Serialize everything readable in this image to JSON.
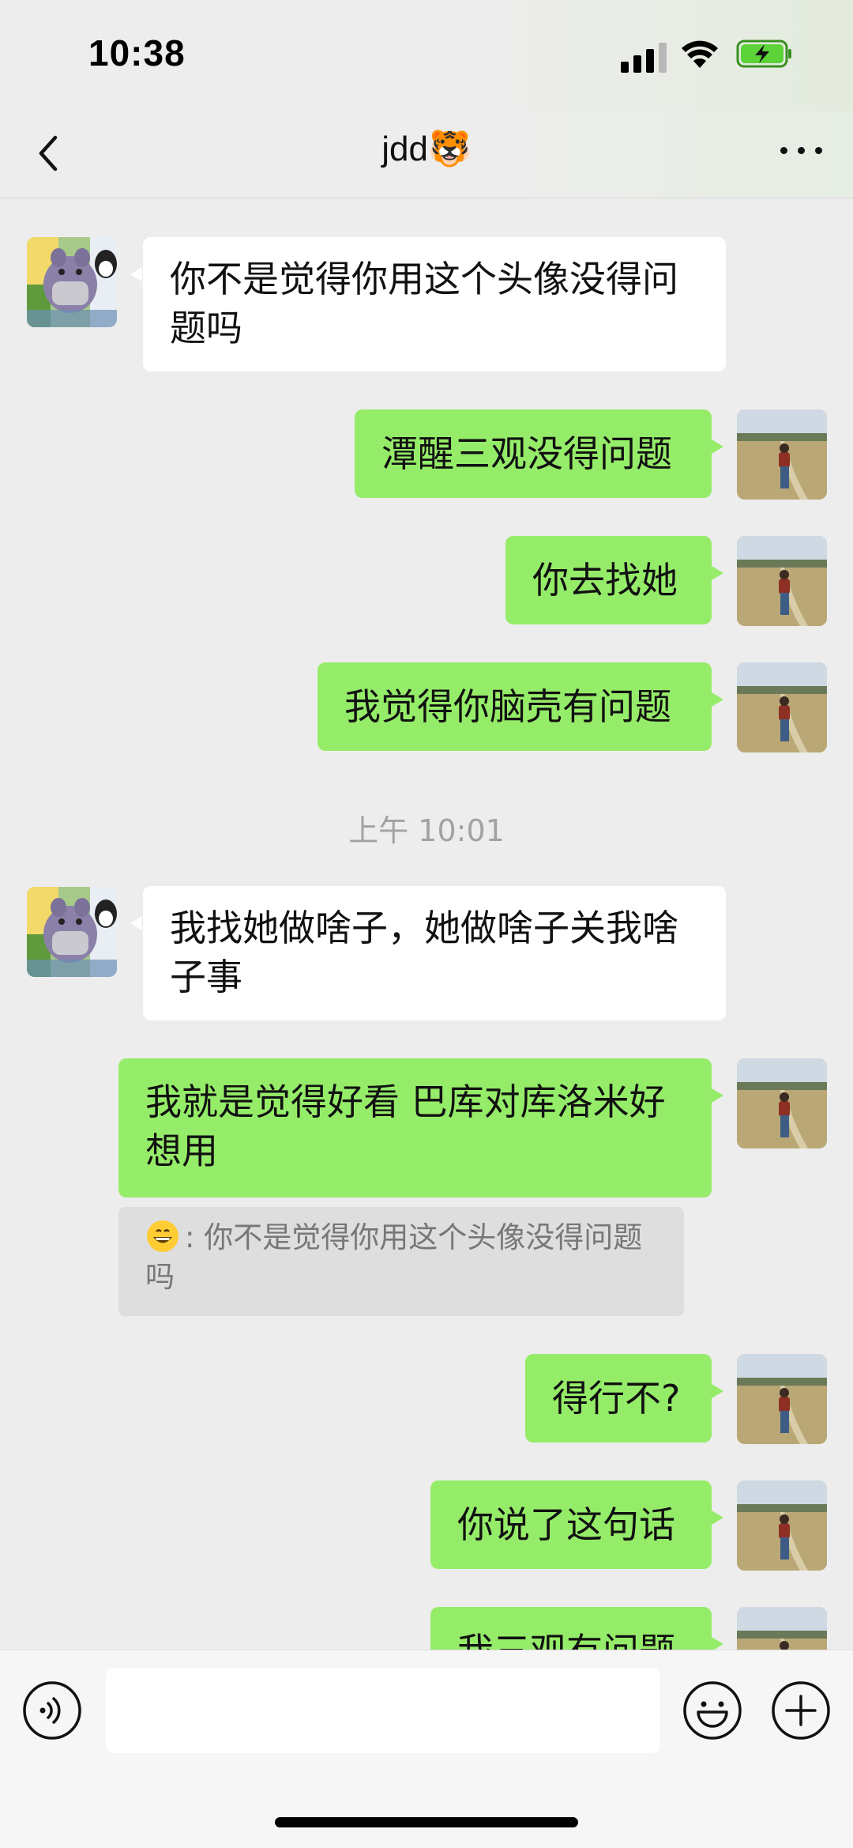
{
  "status_bar": {
    "time": "10:38"
  },
  "header": {
    "title": "jdd🐯"
  },
  "messages": [
    {
      "side": "incoming",
      "text": "你不是觉得你用这个头像没得问题吗"
    },
    {
      "side": "outgoing",
      "text": "潭醒三观没得问题"
    },
    {
      "side": "outgoing",
      "text": "你去找她"
    },
    {
      "side": "outgoing",
      "text": "我觉得你脑壳有问题"
    },
    {
      "side": "timestamp",
      "text": "上午 10:01"
    },
    {
      "side": "incoming",
      "text": "我找她做啥子，她做啥子关我啥子事"
    },
    {
      "side": "outgoing",
      "text": "我就是觉得好看 巴库对库洛米好想用"
    },
    {
      "side": "outgoing",
      "text": "得行不?"
    },
    {
      "side": "outgoing",
      "text": "你说了这句话"
    },
    {
      "side": "outgoing",
      "text": "我三观有问题"
    }
  ],
  "quote": {
    "sender_icon": "grinning-emoji-icon",
    "separator": ":",
    "text": "你不是觉得你用这个头像没得问题吗"
  },
  "input_bar": {
    "placeholder": ""
  },
  "colors": {
    "outgoing_bubble": "#95ec69",
    "incoming_bubble": "#ffffff",
    "background": "#ededed"
  }
}
